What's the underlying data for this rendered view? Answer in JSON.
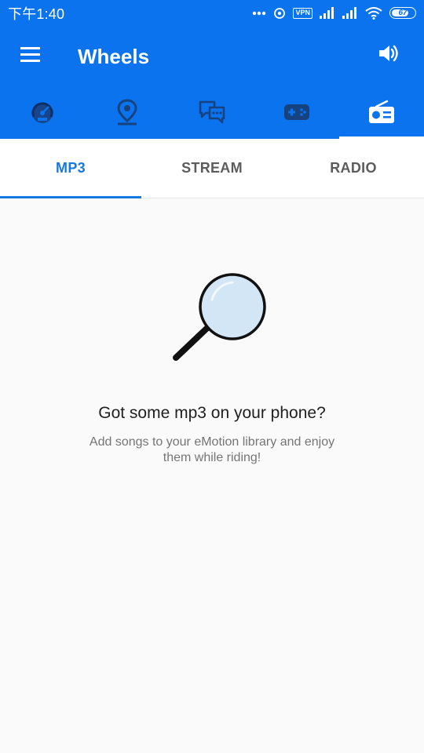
{
  "status_bar": {
    "time": "下午1:40",
    "vpn": "VPN",
    "battery": "67",
    "icons": [
      "more-dots-icon",
      "location-ring-icon",
      "vpn-icon",
      "signal-icon",
      "signal-icon",
      "wifi-icon",
      "battery-icon"
    ]
  },
  "app_bar": {
    "title": "Wheels",
    "menu_icon": "menu-icon",
    "volume_icon": "volume-icon"
  },
  "icon_tabs": [
    {
      "name": "speedometer-icon",
      "active": false
    },
    {
      "name": "map-pin-icon",
      "active": false
    },
    {
      "name": "chat-icon",
      "active": false
    },
    {
      "name": "gamepad-icon",
      "active": false
    },
    {
      "name": "radio-icon",
      "active": true
    }
  ],
  "sub_tabs": [
    {
      "label": "MP3",
      "active": true
    },
    {
      "label": "STREAM",
      "active": false
    },
    {
      "label": "RADIO",
      "active": false
    }
  ],
  "empty_state": {
    "icon": "magnifier-icon",
    "title": "Got some mp3 on your phone?",
    "description": "Add songs to your eMotion library and enjoy them while riding!"
  },
  "colors": {
    "primary": "#0b73ee",
    "tab_active": "#1579df",
    "background": "#fafafa"
  }
}
